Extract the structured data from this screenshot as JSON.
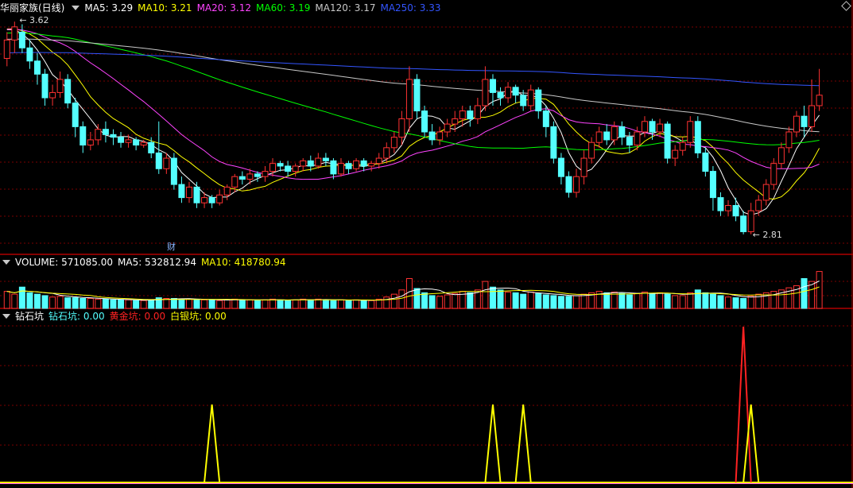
{
  "colors": {
    "bg": "#000000",
    "up": "#ff3232",
    "down": "#54ffff",
    "grid": "#7a0000",
    "ma5": "#ffffff",
    "ma10": "#ffff00",
    "ma20": "#ff44ff",
    "ma60": "#00ff00",
    "ma120": "#c8c8c8",
    "ma250": "#3355ff",
    "vol_ma5": "#ffffff",
    "vol_ma10": "#ffff00",
    "zs": "#54ffff",
    "hj": "#ff2222",
    "by": "#ffff00",
    "pink": "#ff55ff"
  },
  "main_panel": {
    "title": "华丽家族(日线)",
    "ma_labels": [
      {
        "text": "MA5: 3.29",
        "color": "#ffffff"
      },
      {
        "text": "MA10: 3.21",
        "color": "#ffff00"
      },
      {
        "text": "MA20: 3.12",
        "color": "#ff44ff"
      },
      {
        "text": "MA60: 3.19",
        "color": "#00ff00"
      },
      {
        "text": "MA120: 3.17",
        "color": "#c8c8c8"
      },
      {
        "text": "MA250: 3.33",
        "color": "#3355ff"
      }
    ],
    "high_marker": "3.62",
    "low_marker": "2.81",
    "event_marker": "财"
  },
  "volume_panel": {
    "labels": [
      {
        "text": "VOLUME: 571085.00",
        "color": "#ffffff"
      },
      {
        "text": "MA5: 532812.94",
        "color": "#ffffff"
      },
      {
        "text": "MA10: 418780.94",
        "color": "#ffff00"
      }
    ]
  },
  "indicator_panel": {
    "labels": [
      {
        "text": "钻石坑",
        "color": "#ffffff"
      },
      {
        "text": "钻石坑: 0.00",
        "color": "#54ffff"
      },
      {
        "text": "黄金坑: 0.00",
        "color": "#ff2222"
      },
      {
        "text": "白银坑: 0.00",
        "color": "#ffff00"
      }
    ]
  },
  "chart_data": {
    "type": "candlestick",
    "bars": [
      [
        3.48,
        3.55,
        3.45,
        3.58
      ],
      [
        3.55,
        3.6,
        3.5,
        3.62
      ],
      [
        3.58,
        3.52,
        3.5,
        3.61
      ],
      [
        3.52,
        3.47,
        3.44,
        3.55
      ],
      [
        3.47,
        3.42,
        3.38,
        3.5
      ],
      [
        3.42,
        3.33,
        3.3,
        3.44
      ],
      [
        3.33,
        3.35,
        3.3,
        3.38
      ],
      [
        3.35,
        3.4,
        3.33,
        3.43
      ],
      [
        3.4,
        3.31,
        3.29,
        3.42
      ],
      [
        3.31,
        3.22,
        3.18,
        3.33
      ],
      [
        3.22,
        3.15,
        3.12,
        3.24
      ],
      [
        3.15,
        3.17,
        3.13,
        3.2
      ],
      [
        3.17,
        3.21,
        3.15,
        3.23
      ],
      [
        3.21,
        3.19,
        3.16,
        3.24
      ],
      [
        3.19,
        3.18,
        3.15,
        3.21
      ],
      [
        3.18,
        3.16,
        3.14,
        3.2
      ],
      [
        3.16,
        3.17,
        3.14,
        3.19
      ],
      [
        3.17,
        3.15,
        3.13,
        3.18
      ],
      [
        3.15,
        3.16,
        3.14,
        3.17
      ],
      [
        3.16,
        3.12,
        3.1,
        3.18
      ],
      [
        3.12,
        3.06,
        3.04,
        3.24
      ],
      [
        3.06,
        3.1,
        3.04,
        3.12
      ],
      [
        3.1,
        3.0,
        2.98,
        3.12
      ],
      [
        3.0,
        2.95,
        2.93,
        3.03
      ],
      [
        2.95,
        2.99,
        2.93,
        3.01
      ],
      [
        2.99,
        2.93,
        2.91,
        3.01
      ],
      [
        2.93,
        2.95,
        2.91,
        2.97
      ],
      [
        2.95,
        2.93,
        2.91,
        2.96
      ],
      [
        2.93,
        2.96,
        2.92,
        2.98
      ],
      [
        2.96,
        2.99,
        2.94,
        3.0
      ],
      [
        2.99,
        3.03,
        2.97,
        3.04
      ],
      [
        3.03,
        3.02,
        3.0,
        3.05
      ],
      [
        3.02,
        3.04,
        3.0,
        3.06
      ],
      [
        3.04,
        3.03,
        3.01,
        3.05
      ],
      [
        3.03,
        3.05,
        3.01,
        3.07
      ],
      [
        3.05,
        3.08,
        3.03,
        3.1
      ],
      [
        3.08,
        3.07,
        3.05,
        3.09
      ],
      [
        3.07,
        3.05,
        3.03,
        3.09
      ],
      [
        3.05,
        3.07,
        3.03,
        3.08
      ],
      [
        3.07,
        3.09,
        3.05,
        3.1
      ],
      [
        3.09,
        3.07,
        3.05,
        3.11
      ],
      [
        3.07,
        3.1,
        3.06,
        3.12
      ],
      [
        3.1,
        3.09,
        3.07,
        3.12
      ],
      [
        3.09,
        3.04,
        3.02,
        3.1
      ],
      [
        3.04,
        3.08,
        3.03,
        3.1
      ],
      [
        3.08,
        3.06,
        3.04,
        3.09
      ],
      [
        3.06,
        3.09,
        3.05,
        3.1
      ],
      [
        3.09,
        3.07,
        3.05,
        3.1
      ],
      [
        3.07,
        3.08,
        3.05,
        3.09
      ],
      [
        3.08,
        3.1,
        3.06,
        3.12
      ],
      [
        3.1,
        3.14,
        3.08,
        3.16
      ],
      [
        3.14,
        3.18,
        3.12,
        3.2
      ],
      [
        3.18,
        3.25,
        3.15,
        3.28
      ],
      [
        3.25,
        3.4,
        3.2,
        3.45
      ],
      [
        3.4,
        3.28,
        3.25,
        3.42
      ],
      [
        3.28,
        3.2,
        3.18,
        3.3
      ],
      [
        3.2,
        3.17,
        3.15,
        3.23
      ],
      [
        3.17,
        3.2,
        3.15,
        3.22
      ],
      [
        3.2,
        3.23,
        3.18,
        3.25
      ],
      [
        3.23,
        3.25,
        3.2,
        3.28
      ],
      [
        3.25,
        3.28,
        3.22,
        3.3
      ],
      [
        3.28,
        3.25,
        3.22,
        3.3
      ],
      [
        3.25,
        3.3,
        3.23,
        3.33
      ],
      [
        3.3,
        3.4,
        3.28,
        3.45
      ],
      [
        3.4,
        3.35,
        3.3,
        3.42
      ],
      [
        3.35,
        3.33,
        3.3,
        3.37
      ],
      [
        3.33,
        3.37,
        3.31,
        3.39
      ],
      [
        3.37,
        3.34,
        3.31,
        3.38
      ],
      [
        3.34,
        3.3,
        3.28,
        3.36
      ],
      [
        3.3,
        3.36,
        3.28,
        3.38
      ],
      [
        3.36,
        3.28,
        3.25,
        3.37
      ],
      [
        3.28,
        3.22,
        3.18,
        3.3
      ],
      [
        3.22,
        3.1,
        3.08,
        3.24
      ],
      [
        3.1,
        3.03,
        3.0,
        3.12
      ],
      [
        3.03,
        2.97,
        2.95,
        3.05
      ],
      [
        2.97,
        3.03,
        2.95,
        3.06
      ],
      [
        3.03,
        3.1,
        3.0,
        3.13
      ],
      [
        3.1,
        3.16,
        3.08,
        3.18
      ],
      [
        3.16,
        3.2,
        3.14,
        3.22
      ],
      [
        3.2,
        3.17,
        3.15,
        3.23
      ],
      [
        3.17,
        3.22,
        3.15,
        3.24
      ],
      [
        3.22,
        3.18,
        3.15,
        3.24
      ],
      [
        3.18,
        3.15,
        3.12,
        3.2
      ],
      [
        3.15,
        3.2,
        3.13,
        3.22
      ],
      [
        3.2,
        3.24,
        3.18,
        3.26
      ],
      [
        3.24,
        3.2,
        3.17,
        3.25
      ],
      [
        3.2,
        3.23,
        3.18,
        3.25
      ],
      [
        3.23,
        3.1,
        3.08,
        3.24
      ],
      [
        3.1,
        3.13,
        3.07,
        3.15
      ],
      [
        3.13,
        3.16,
        3.11,
        3.18
      ],
      [
        3.16,
        3.24,
        3.14,
        3.26
      ],
      [
        3.24,
        3.12,
        3.1,
        3.26
      ],
      [
        3.12,
        3.05,
        3.03,
        3.14
      ],
      [
        3.05,
        2.95,
        2.9,
        3.07
      ],
      [
        2.95,
        2.9,
        2.88,
        2.97
      ],
      [
        2.9,
        2.92,
        2.88,
        2.94
      ],
      [
        2.92,
        2.88,
        2.86,
        2.95
      ],
      [
        2.88,
        2.82,
        2.81,
        2.9
      ],
      [
        2.82,
        2.9,
        2.81,
        2.93
      ],
      [
        2.9,
        2.94,
        2.88,
        2.96
      ],
      [
        2.94,
        3.0,
        2.92,
        3.02
      ],
      [
        3.0,
        3.08,
        2.98,
        3.1
      ],
      [
        3.08,
        3.14,
        3.06,
        3.16
      ],
      [
        3.14,
        3.2,
        3.12,
        3.22
      ],
      [
        3.2,
        3.26,
        3.18,
        3.28
      ],
      [
        3.26,
        3.22,
        3.18,
        3.3
      ],
      [
        3.22,
        3.3,
        3.2,
        3.4
      ],
      [
        3.3,
        3.34,
        3.28,
        3.44
      ]
    ],
    "volume": [
      240,
      200,
      300,
      220,
      200,
      180,
      160,
      170,
      150,
      150,
      140,
      140,
      130,
      130,
      120,
      120,
      120,
      110,
      110,
      120,
      150,
      140,
      140,
      130,
      130,
      120,
      120,
      120,
      110,
      120,
      130,
      120,
      120,
      110,
      120,
      130,
      120,
      110,
      120,
      130,
      120,
      130,
      120,
      110,
      120,
      110,
      120,
      110,
      110,
      130,
      160,
      200,
      260,
      420,
      280,
      220,
      180,
      170,
      190,
      210,
      240,
      220,
      260,
      380,
      300,
      260,
      230,
      220,
      200,
      230,
      210,
      190,
      180,
      170,
      170,
      180,
      200,
      220,
      240,
      220,
      230,
      210,
      190,
      210,
      230,
      210,
      220,
      200,
      180,
      180,
      220,
      260,
      220,
      200,
      180,
      160,
      150,
      140,
      170,
      200,
      220,
      240,
      260,
      290,
      320,
      420,
      380,
      520
    ],
    "indicator": {
      "zuanshi": [],
      "huangjin": [
        {
          "index": 97,
          "value": 2
        }
      ],
      "baiyin": [
        {
          "index": 27,
          "value": 1
        },
        {
          "index": 64,
          "value": 1
        },
        {
          "index": 68,
          "value": 1
        },
        {
          "index": 98,
          "value": 1
        }
      ]
    }
  }
}
